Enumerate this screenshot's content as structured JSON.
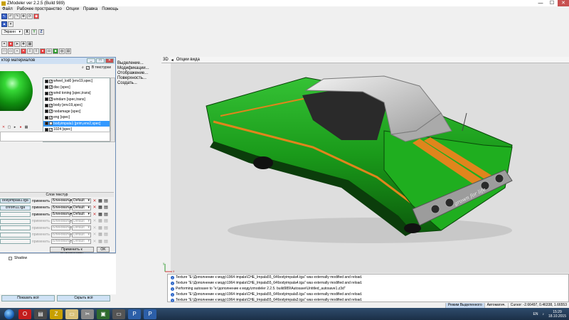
{
  "app": {
    "title": "ZModeler ver 2.2.5 (Build 989)",
    "min": "—",
    "max": "☐",
    "close": "✕"
  },
  "menu": [
    "Файл",
    "Рабочее пространство",
    "Опции",
    "Правка",
    "Помощь"
  ],
  "toolbar": {
    "mode_combo": "Экранн",
    "axis_x": "X",
    "axis_y": "Y",
    "axis_z": "Z"
  },
  "modifiers": [
    "Выделение...",
    "Модификации...",
    "Отображение...",
    "Поверхность...",
    "Создать..."
  ],
  "viewport": {
    "label": "3D",
    "options": "Опции вида"
  },
  "material_editor": {
    "title": "ктор материалов",
    "textures_checkbox": "В текстурах",
    "materials": [
      {
        "name": "wheel_lod0 [env19,spec]",
        "selected": false
      },
      {
        "name": "disc [spec]",
        "selected": false
      },
      {
        "name": "wind toning [spec,trans]",
        "selected": false
      },
      {
        "name": "windarn [spec,trans]",
        "selected": false
      },
      {
        "name": "body [env19,spec]",
        "selected": false
      },
      {
        "name": "nodamage [spec]",
        "selected": false
      },
      {
        "name": "eng [spec]",
        "selected": false
      },
      {
        "name": "bodyimpala1 [prim,env2,spec]",
        "selected": true
      },
      {
        "name": "1024 [spec]",
        "selected": false
      }
    ],
    "layers_header": "Слои текстур",
    "layers": [
      {
        "name": "bodyimpala1.tga",
        "op": "применить",
        "blend": "Блиновать",
        "mode": "Default",
        "enabled": true
      },
      {
        "name": "chrom11.tga",
        "op": "применить",
        "blend": "Блиновать",
        "mode": "Default",
        "enabled": true
      },
      {
        "name": "",
        "op": "применить",
        "blend": "Блиновать",
        "mode": "Default",
        "enabled": true
      },
      {
        "name": "",
        "op": "применить",
        "blend": "Блиновать",
        "mode": "Default",
        "enabled": false
      },
      {
        "name": "",
        "op": "применить",
        "blend": "Блиновать",
        "mode": "Default",
        "enabled": false
      },
      {
        "name": "",
        "op": "применить",
        "blend": "Блиновать",
        "mode": "Default",
        "enabled": false
      },
      {
        "name": "",
        "op": "применить",
        "blend": "Блиновать",
        "mode": "Default",
        "enabled": false
      }
    ],
    "apply_button": "Применить к выделенному",
    "ok_button": "OK"
  },
  "left_panel": {
    "shadow": "Shadow",
    "show_all": "Показать всё",
    "hide_all": "Скрыть всё"
  },
  "log": [
    "Texture \"E:\\Дополнение к моду\\1964 impala\\CHE_Impala55_64\\bodyimpala4.tga\" was externally modified and reload.",
    "Texture \"E:\\Дополнение к моду\\1964 impala\\CHE_Impala55_64\\bodyimpala4.tga\" was externally modified and reload.",
    "Performing autosave to \"e:\\дополнение к моду\\zmodeler 2.2.5. build989\\Autosave\\Untitled_autosave1.z3d\"",
    "Texture \"E:\\Дополнение к моду\\1964 impala\\CHE_Impala55_64\\bodyimpala5.tga\" was externally modified and reload.",
    "Texture \"E:\\Дополнение к моду\\1964 impala\\CHE_Impala55_64\\bodyimpala3.tga\" was externally modified and reload."
  ],
  "status": {
    "mode": "Режим Выделенного",
    "auto": "Автоматич.",
    "cursor": "Cursor: -2.66497, 0.46338, 1.66553"
  },
  "tray": {
    "lang": "EN",
    "time": "15:29",
    "date": "18.10.2015"
  },
  "car_decal": "grown for life",
  "colors": {
    "body_green": "#1aa31a",
    "stripe_orange": "#e0851c",
    "roof_silver": "#c9c9c9"
  }
}
